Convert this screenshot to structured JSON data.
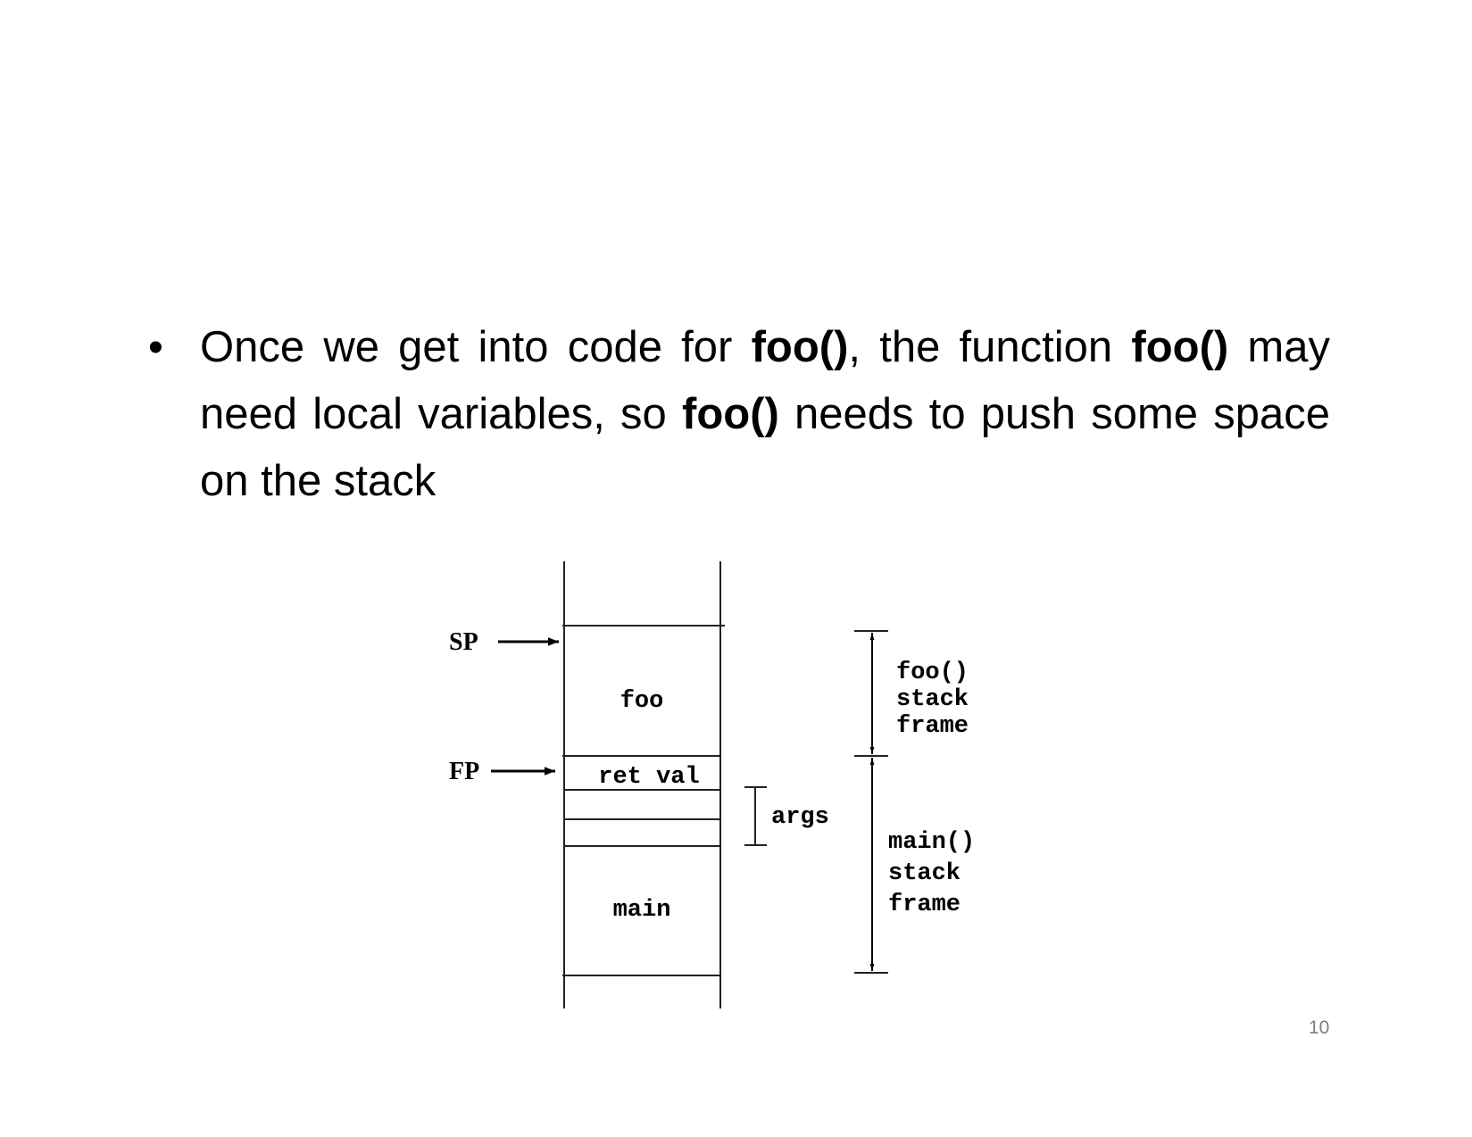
{
  "slide": {
    "bullet_symbol": "•",
    "segments": [
      {
        "text": "Once we get into code for ",
        "bold": false
      },
      {
        "text": "foo()",
        "bold": true
      },
      {
        "text": ", the function ",
        "bold": false
      },
      {
        "text": "foo()",
        "bold": true
      },
      {
        "text": " may need local variables, so ",
        "bold": false
      },
      {
        "text": "foo()",
        "bold": true
      },
      {
        "text": " needs to push some space on the stack",
        "bold": false
      }
    ],
    "page_number": "10"
  },
  "diagram": {
    "sp_label": "SP",
    "fp_label": "FP",
    "foo_cell": "foo",
    "ret_val_cell": "ret val",
    "main_cell": "main",
    "args_label": "args",
    "foo_frame": [
      "foo()",
      "stack",
      "frame"
    ],
    "main_frame": [
      "main()",
      "stack",
      "frame"
    ]
  }
}
